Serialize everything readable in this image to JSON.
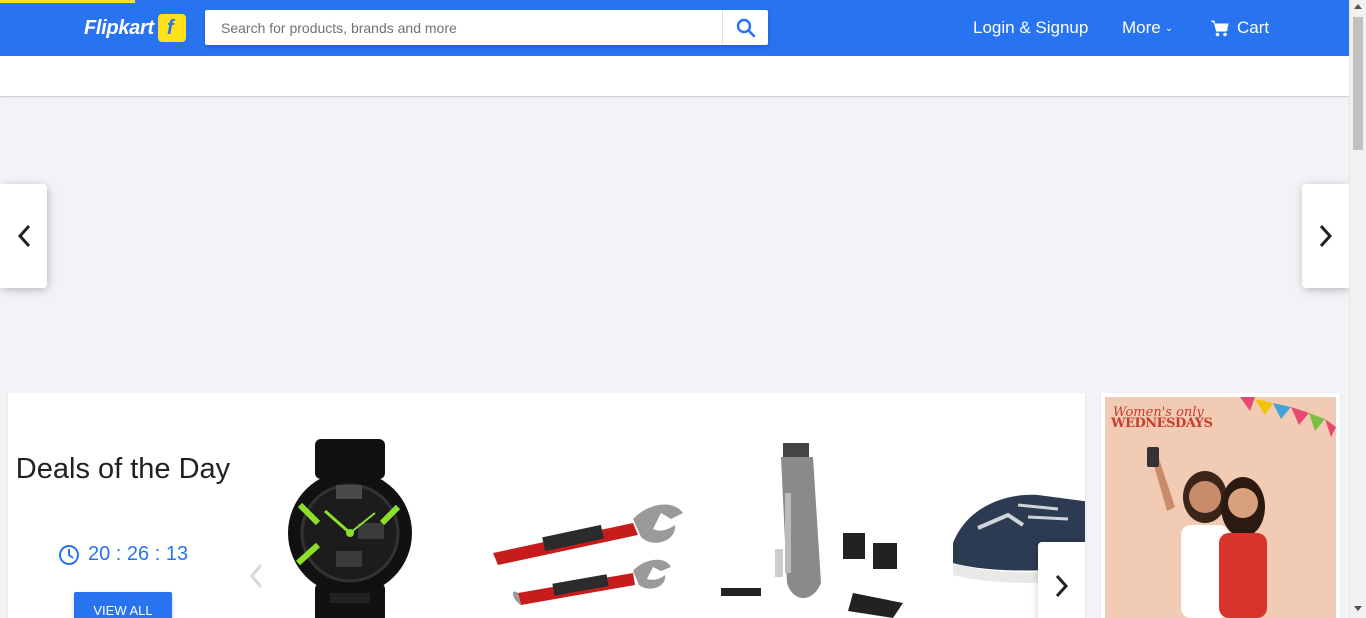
{
  "header": {
    "logo_text": "Flipkart",
    "logo_mark": "f",
    "search_placeholder": "Search for products, brands and more",
    "login_label": "Login & Signup",
    "more_label": "More",
    "cart_label": "Cart"
  },
  "colors": {
    "brand": "#2874f0",
    "accent": "#ffe11b",
    "page_bg": "#f1f3f6"
  },
  "loading_progress": 0.1,
  "deals": {
    "title": "Deals of the Day",
    "timer": "20 : 26 : 13",
    "view_all_label": "VIEW ALL",
    "products": [
      {
        "name": "watch-product"
      },
      {
        "name": "wrench-product"
      },
      {
        "name": "trimmer-product"
      },
      {
        "name": "shoe-product"
      }
    ]
  },
  "banner": {
    "line1": "Women's only",
    "line2": "WEDNESDAYS"
  },
  "icons": {
    "search": "search-icon",
    "cart": "cart-icon",
    "more": "chevron-down-icon",
    "prev": "chevron-left-icon",
    "next": "chevron-right-icon",
    "clock": "clock-icon"
  }
}
